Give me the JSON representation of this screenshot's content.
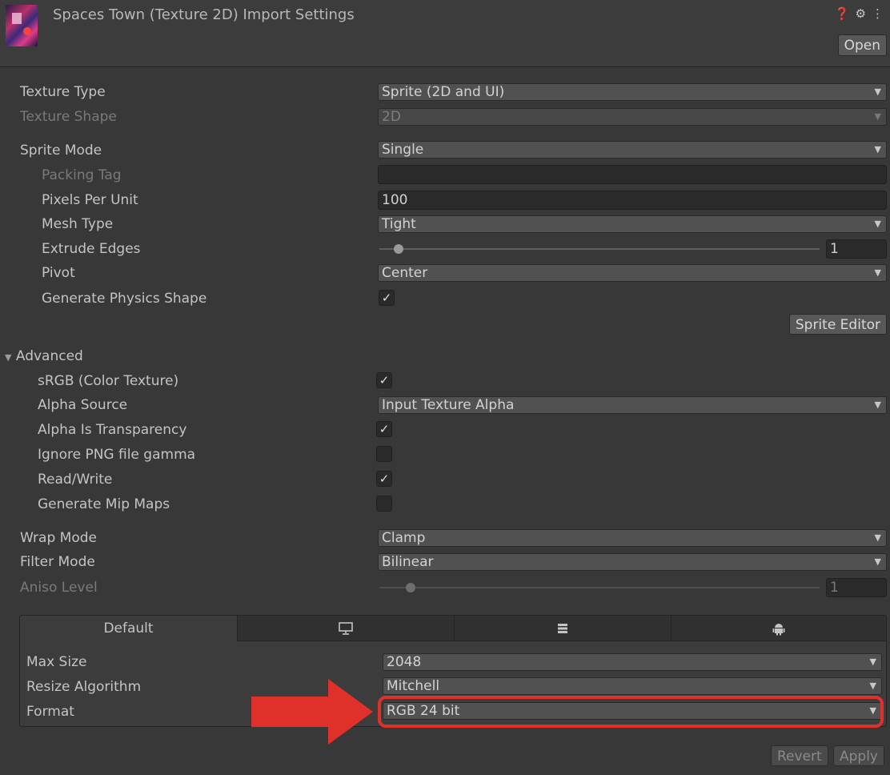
{
  "header": {
    "title": "Spaces Town (Texture 2D) Import Settings",
    "open_label": "Open"
  },
  "icons": {
    "help": "help-icon",
    "presets": "presets-icon",
    "menu": "kebab-menu-icon",
    "arrow": "red-arrow-icon"
  },
  "fields": {
    "texture_type": {
      "label": "Texture Type",
      "value": "Sprite (2D and UI)"
    },
    "texture_shape": {
      "label": "Texture Shape",
      "value": "2D"
    },
    "sprite_mode": {
      "label": "Sprite Mode",
      "value": "Single"
    },
    "packing_tag": {
      "label": "Packing Tag",
      "value": ""
    },
    "pixels_per_unit": {
      "label": "Pixels Per Unit",
      "value": "100"
    },
    "mesh_type": {
      "label": "Mesh Type",
      "value": "Tight"
    },
    "extrude_edges": {
      "label": "Extrude Edges",
      "value": "1"
    },
    "pivot": {
      "label": "Pivot",
      "value": "Center"
    },
    "generate_physics_shape": {
      "label": "Generate Physics Shape",
      "checked": true
    },
    "sprite_editor_label": "Sprite Editor"
  },
  "advanced": {
    "label": "Advanced",
    "srgb": {
      "label": "sRGB (Color Texture)",
      "checked": true
    },
    "alpha_source": {
      "label": "Alpha Source",
      "value": "Input Texture Alpha"
    },
    "alpha_is_transparency": {
      "label": "Alpha Is Transparency",
      "checked": true
    },
    "ignore_png_gamma": {
      "label": "Ignore PNG file gamma",
      "checked": false
    },
    "read_write": {
      "label": "Read/Write",
      "checked": true
    },
    "generate_mip_maps": {
      "label": "Generate Mip Maps",
      "checked": false
    }
  },
  "wrap": {
    "wrap_mode": {
      "label": "Wrap Mode",
      "value": "Clamp"
    },
    "filter_mode": {
      "label": "Filter Mode",
      "value": "Bilinear"
    },
    "aniso_level": {
      "label": "Aniso Level",
      "value": "1"
    }
  },
  "platform": {
    "tabs": [
      {
        "label": "Default"
      },
      {
        "icon": "monitor-icon"
      },
      {
        "icon": "server-icon"
      },
      {
        "icon": "android-icon"
      }
    ],
    "max_size": {
      "label": "Max Size",
      "value": "2048"
    },
    "resize_algorithm": {
      "label": "Resize Algorithm",
      "value": "Mitchell"
    },
    "format": {
      "label": "Format",
      "value": "RGB 24 bit"
    }
  },
  "footer": {
    "revert_label": "Revert",
    "apply_label": "Apply"
  },
  "colors": {
    "background": "#383838",
    "highlight": "#e0302a"
  }
}
